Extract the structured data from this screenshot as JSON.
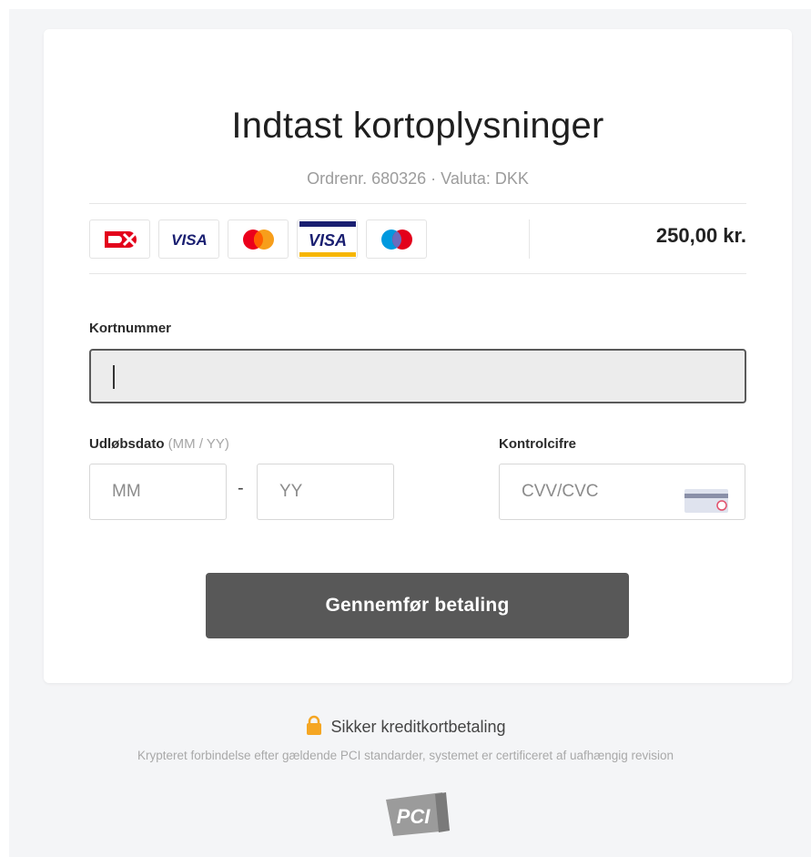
{
  "form": {
    "title": "Indtast kortoplysninger",
    "subtitle": "Ordrenr. 680326 · Valuta: DKK",
    "amount": "250,00 kr.",
    "card_logos": [
      "dankort-logo",
      "visa-logo",
      "mastercard-logo",
      "visa-electron-logo",
      "maestro-logo"
    ],
    "card_number_label": "Kortnummer",
    "card_number_value": "",
    "expiry_label": "Udløbsdato",
    "expiry_hint": "(MM / YY)",
    "month_placeholder": "MM",
    "separator": "-",
    "year_placeholder": "YY",
    "cvv_label": "Kontrolcifre",
    "cvv_placeholder": "CVV/CVC",
    "submit_label": "Gennemfør betaling"
  },
  "footer": {
    "secure_label": "Sikker kreditkortbetaling",
    "pci_note": "Krypteret forbindelse efter gældende PCI standarder, systemet er certificeret af uafhængig revision"
  },
  "colors": {
    "button": "#585858",
    "input_bg": "#ececec",
    "page_bg": "#f4f5f7",
    "lock": "#f5a623"
  }
}
